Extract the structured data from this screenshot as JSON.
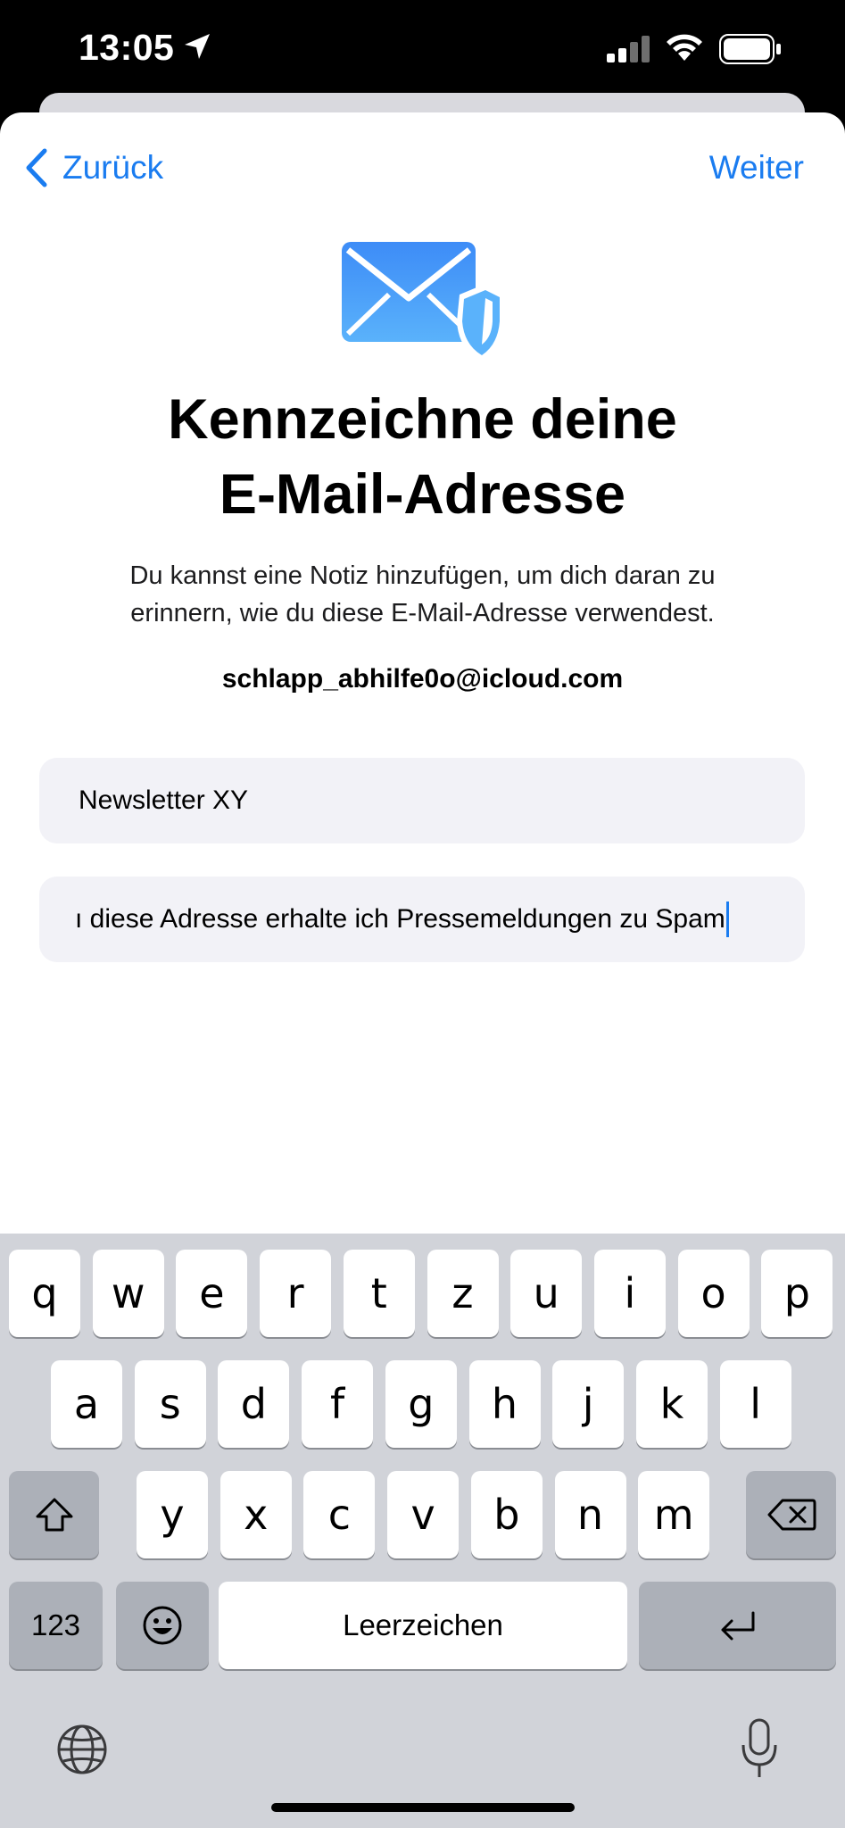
{
  "status": {
    "time": "13:05"
  },
  "nav": {
    "back_label": "Zurück",
    "next_label": "Weiter"
  },
  "content": {
    "title_line1": "Kennzeichne deine",
    "title_line2": "E-Mail-Adresse",
    "subtitle_line1": "Du kannst eine Notiz hinzufügen, um dich daran zu",
    "subtitle_line2": "erinnern, wie du diese E-Mail-Adresse verwendest.",
    "email": "schlapp_abhilfe0o@icloud.com"
  },
  "fields": {
    "label_value": "Newsletter XY",
    "note_value": "ı diese Adresse erhalte ich Pressemeldungen zu Spam"
  },
  "keyboard": {
    "row1": [
      "q",
      "w",
      "e",
      "r",
      "t",
      "z",
      "u",
      "i",
      "o",
      "p"
    ],
    "row2": [
      "a",
      "s",
      "d",
      "f",
      "g",
      "h",
      "j",
      "k",
      "l"
    ],
    "row3": [
      "y",
      "x",
      "c",
      "v",
      "b",
      "n",
      "m"
    ],
    "numbers_label": "123",
    "space_label": "Leerzeichen"
  },
  "colors": {
    "accent": "#1a7cf0",
    "field_bg": "#f2f2f7",
    "keyboard_bg": "#d1d3d9"
  },
  "icons": [
    "location-arrow-icon",
    "signal-icon",
    "wifi-icon",
    "battery-icon",
    "chevron-left-icon",
    "mail-shield-icon",
    "shift-icon",
    "backspace-icon",
    "emoji-icon",
    "return-icon",
    "globe-icon",
    "microphone-icon"
  ]
}
